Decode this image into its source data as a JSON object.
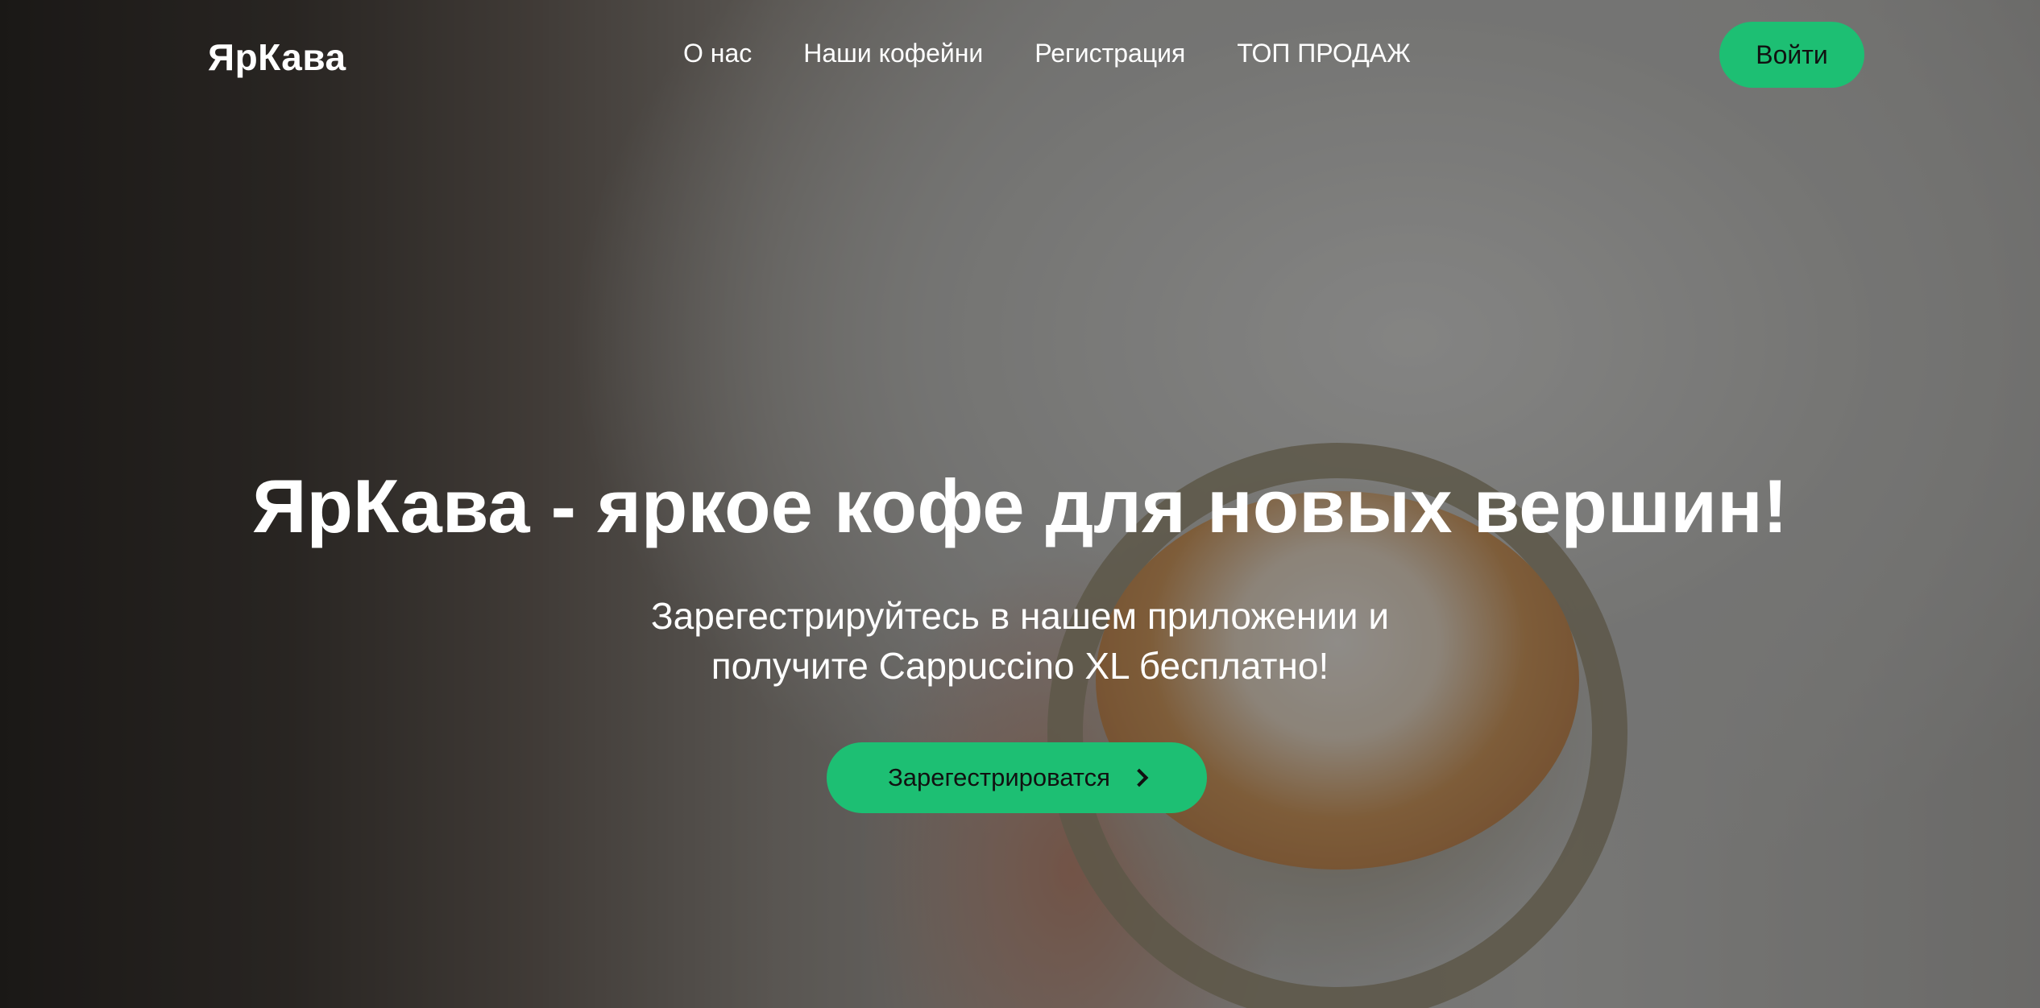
{
  "brand": {
    "logo_text": "ЯрКава",
    "accent_color": "#1dbf73"
  },
  "nav": {
    "items": [
      {
        "label": "О нас"
      },
      {
        "label": "Наши кофейни"
      },
      {
        "label": "Регистрация"
      },
      {
        "label": "ТОП ПРОДАЖ"
      }
    ]
  },
  "header": {
    "login_label": "Войти"
  },
  "hero": {
    "title": "ЯрКава - яркое кофе для новых вершин!",
    "subtitle_line1": "Зарегестрируйтесь в нашем приложении и",
    "subtitle_line2": "получите Cappuccino XL бесплатно!",
    "cta_label": "Зарегестрироватся",
    "cta_icon": "chevron-right-icon",
    "background_image": "latte-art-cup-photo"
  }
}
